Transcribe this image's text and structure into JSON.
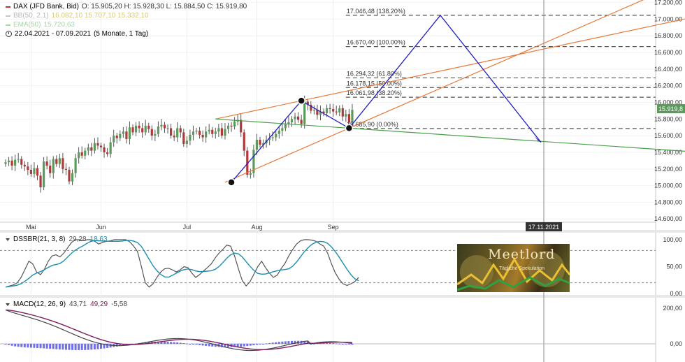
{
  "legend": {
    "instrument": "DAX (JFD Bank, Bid)",
    "ohlc": "O: 15.905,20  H: 15.928,30  L: 15.884,50  C: 15.919,80",
    "bb": "BB(50, 2.1)",
    "bb_values": "16.082,10  15.707,10  15.332,10",
    "ema": "EMA(50)",
    "ema_value": "15.720,63",
    "range": "22.04.2021 - 07.09.2021",
    "range_note": "(5 Monate, 1 Tag)"
  },
  "colors": {
    "up": "#5a9a5a",
    "down": "#b03a3a",
    "wick": "#555555",
    "fib_line": "#555555",
    "channel": "#e87838",
    "green_line": "#4aa04a",
    "projection": "#2020c0",
    "bb_legend": "#c8c8c8",
    "bb_mid": "#e8d44a",
    "ema_legend": "#a8d8a8",
    "stoch_k": "#555555",
    "stoch_d": "#1a8fb0",
    "macd_line": "#444444",
    "signal_line": "#802060",
    "histogram": "#7070e0"
  },
  "chart_data": [
    {
      "type": "candlestick",
      "title": "DAX (JFD Bank, Bid)",
      "x_ticks": [
        "Mai",
        "Jun",
        "Jul",
        "Aug",
        "Sep"
      ],
      "y_ticks": [
        "14.600,00",
        "14.800,00",
        "15.000,00",
        "15.200,00",
        "15.400,00",
        "15.600,00",
        "15.800,00",
        "16.000,00",
        "16.200,00",
        "16.400,00",
        "16.600,00",
        "16.800,00",
        "17.000,00",
        "17.200,00"
      ],
      "ylim": [
        14560,
        17230
      ],
      "last_price": "15.919,8",
      "date_marker": "17.11.2021",
      "closes": [
        15280,
        15300,
        15240,
        15310,
        15320,
        15250,
        15230,
        15190,
        15140,
        15210,
        15120,
        14980,
        15290,
        15240,
        15150,
        15320,
        15260,
        15330,
        15200,
        15190,
        15050,
        15150,
        15330,
        15400,
        15360,
        15420,
        15460,
        15420,
        15510,
        15480,
        15460,
        15400,
        15380,
        15520,
        15600,
        15570,
        15620,
        15650,
        15560,
        15700,
        15640,
        15720,
        15690,
        15640,
        15720,
        15680,
        15600,
        15620,
        15710,
        15730,
        15690,
        15690,
        15600,
        15580,
        15690,
        15640,
        15500,
        15540,
        15610,
        15650,
        15660,
        15610,
        15580,
        15650,
        15670,
        15620,
        15650,
        15690,
        15600,
        15680,
        15720,
        15710,
        15770,
        15790,
        15640,
        15420,
        15130,
        15150,
        15430,
        15550,
        15490,
        15510,
        15550,
        15570,
        15580,
        15620,
        15660,
        15690,
        15740,
        15760,
        15800,
        15830,
        15790,
        15740,
        16010,
        15970,
        15900,
        15910,
        15850,
        15890,
        15870,
        15930,
        15920,
        15890,
        15880,
        15930,
        15830,
        15860,
        15760,
        15910
      ],
      "fib_levels": [
        {
          "price": 17046.48,
          "label": "17.046,48 (138.20%)"
        },
        {
          "price": 16670.4,
          "label": "16.670,40 (100.00%)"
        },
        {
          "price": 16294.32,
          "label": "16.294,32 (61.80%)"
        },
        {
          "price": 16178.15,
          "label": "16.178,15 (50.00%)"
        },
        {
          "price": 16061.98,
          "label": "16.061,98 (38.20%)"
        },
        {
          "price": 15685.9,
          "label": "15.685,90 (0.00%)"
        }
      ]
    },
    {
      "type": "line",
      "title": "DSSBR(21, 3, 8)",
      "values_text": [
        "29,28",
        "18,63"
      ],
      "y_ticks": [
        "0,00",
        "50,00",
        "100,00"
      ],
      "ylim": [
        0,
        100
      ]
    },
    {
      "type": "line",
      "title": "MACD(12, 26, 9)",
      "values_text": [
        "43,71",
        "49,29",
        "-5,58"
      ],
      "y_ticks": [
        "0,00",
        "200,00"
      ]
    }
  ],
  "logo": {
    "title": "Meetlord",
    "subtitle": "Tägliche Spekulation"
  }
}
